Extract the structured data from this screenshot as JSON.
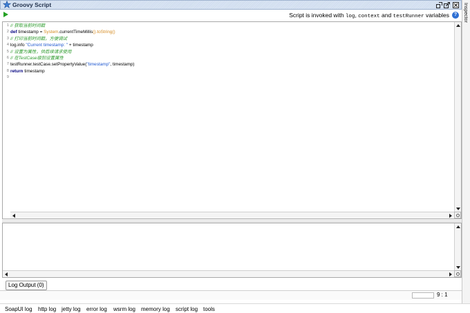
{
  "window": {
    "title": "Groovy Script",
    "buttons": [
      "restore-icon",
      "float-icon",
      "close-icon"
    ]
  },
  "inspector": {
    "label": "Inspector"
  },
  "toolbar": {
    "run_icon": "play-icon",
    "info_prefix": "Script is invoked with ",
    "info_var1": "log",
    "info_sep1": ", ",
    "info_var2": "context",
    "info_sep2": " and ",
    "info_var3": "testRunner",
    "info_suffix": " variables",
    "help_icon": "?"
  },
  "editor": {
    "lines": [
      {
        "n": "1",
        "parts": [
          {
            "t": "// 获取当前时间戳",
            "c": "cmt"
          }
        ]
      },
      {
        "n": "2",
        "parts": [
          {
            "t": "def",
            "c": "kw"
          },
          {
            "t": " timestamp = ",
            "c": ""
          },
          {
            "t": "System",
            "c": "fn"
          },
          {
            "t": ".currentTimeMillis",
            "c": ""
          },
          {
            "t": "().toString()",
            "c": "fn"
          }
        ]
      },
      {
        "n": "3",
        "parts": [
          {
            "t": "// 打印当前时间戳，方便调试",
            "c": "cmt"
          }
        ]
      },
      {
        "n": "4",
        "parts": [
          {
            "t": "log.info ",
            "c": ""
          },
          {
            "t": "\"Current timestamp: \"",
            "c": "str"
          },
          {
            "t": " + timestamp",
            "c": ""
          }
        ]
      },
      {
        "n": "5",
        "parts": [
          {
            "t": "// 设置为属性，供后续请求使用",
            "c": "cmt"
          }
        ]
      },
      {
        "n": "6",
        "parts": [
          {
            "t": "// 在TestCase级别设置属性",
            "c": "cmt"
          }
        ]
      },
      {
        "n": "7",
        "parts": [
          {
            "t": "testRunner.testCase.setPropertyValue(",
            "c": ""
          },
          {
            "t": "\"timestamp\"",
            "c": "str"
          },
          {
            "t": ", timestamp)",
            "c": ""
          }
        ]
      },
      {
        "n": "8",
        "parts": [
          {
            "t": "return",
            "c": "kw"
          },
          {
            "t": " timestamp",
            "c": ""
          }
        ]
      },
      {
        "n": "9",
        "parts": []
      }
    ]
  },
  "log": {
    "button_label": "Log Output (0)"
  },
  "status": {
    "cursor_position": "9 : 1"
  },
  "bottom_tabs": [
    "SoapUI log",
    "http log",
    "jetty log",
    "error log",
    "wsrm log",
    "memory log",
    "script log",
    "tools"
  ]
}
